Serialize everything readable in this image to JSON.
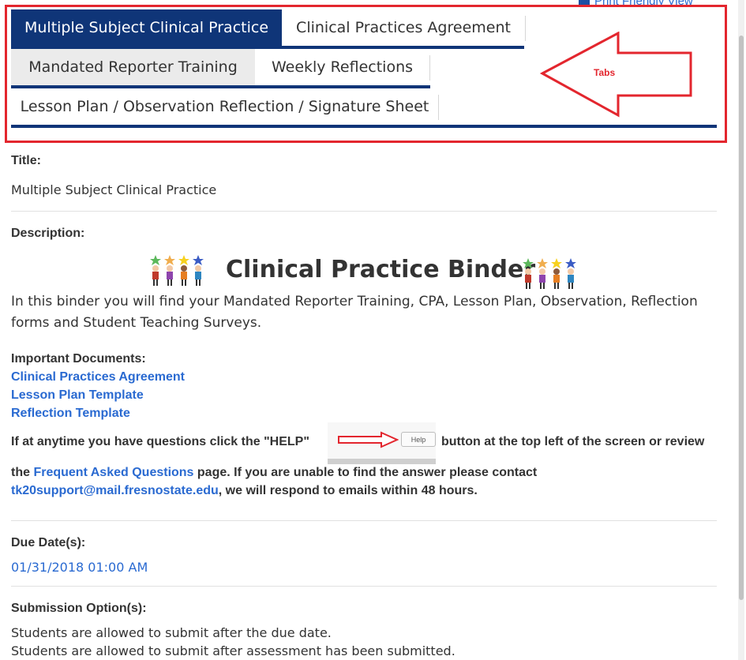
{
  "top": {
    "print_label": "Print Friendly View"
  },
  "annotation": {
    "label": "Tabs"
  },
  "tabs": [
    {
      "label": "Multiple Subject Clinical Practice"
    },
    {
      "label": "Clinical Practices Agreement"
    },
    {
      "label": "Mandated Reporter Training"
    },
    {
      "label": "Weekly Reflections"
    },
    {
      "label": "Lesson Plan / Observation Reflection / Signature Sheet"
    }
  ],
  "title_field": {
    "label": "Title:",
    "value": "Multiple Subject Clinical Practice"
  },
  "description": {
    "label": "Description:",
    "binder_title": "Clinical Practice Binder",
    "intro": "In this binder you will find your Mandated Reporter Training, CPA, Lesson Plan, Observation, Reflection forms and Student Teaching Surveys.",
    "docs_heading": "Important Documents:",
    "docs": [
      "Clinical Practices Agreement",
      "Lesson Plan Template",
      "Reflection Template"
    ],
    "help_text_1": "If at anytime you have questions click the \"HELP\"",
    "help_button": "Help",
    "help_text_2": "button at the top left of the screen or review",
    "line_a_prefix": "the",
    "faq_link": "Frequent Asked Questions",
    "line_a_suffix": "page. If you are unable to find the answer please contact",
    "email_link": "tk20support@mail.fresnostate.edu",
    "line_b_suffix": ", we will respond to emails within 48 hours."
  },
  "due": {
    "label": "Due Date(s):",
    "value": "01/31/2018 01:00 AM"
  },
  "submission": {
    "label": "Submission Option(s):",
    "options": [
      "Students are allowed to submit after the due date.",
      "Students are allowed to submit after assessment has been submitted."
    ]
  },
  "colors": {
    "accent": "#0f3578",
    "link": "#2a6ad1",
    "annotation": "#e3262e",
    "tab_grey": "#ebebeb"
  }
}
